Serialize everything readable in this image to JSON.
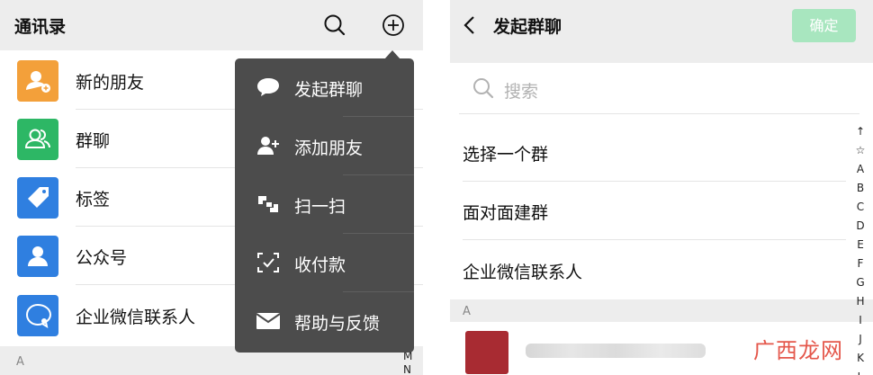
{
  "left": {
    "header": {
      "title": "通讯录"
    },
    "contacts": [
      {
        "label": "新的朋友",
        "color": "#f3a03a",
        "icon": "add-friend-icon"
      },
      {
        "label": "群聊",
        "color": "#2db765",
        "icon": "group-icon"
      },
      {
        "label": "标签",
        "color": "#2f7fe0",
        "icon": "tag-icon"
      },
      {
        "label": "公众号",
        "color": "#2f7fe0",
        "icon": "official-account-icon"
      },
      {
        "label": "企业微信联系人",
        "color": "#2f7fe0",
        "icon": "work-contact-icon"
      }
    ],
    "section": "A",
    "index_letters": [
      "M",
      "N"
    ],
    "popover": [
      {
        "label": "发起群聊",
        "icon": "chat-bubble-icon"
      },
      {
        "label": "添加朋友",
        "icon": "add-friend-icon"
      },
      {
        "label": "扫一扫",
        "icon": "scan-icon"
      },
      {
        "label": "收付款",
        "icon": "payment-icon"
      },
      {
        "label": "帮助与反馈",
        "icon": "mail-icon"
      }
    ]
  },
  "right": {
    "header": {
      "title": "发起群聊",
      "confirm_label": "确定"
    },
    "search": {
      "placeholder": "搜索"
    },
    "options": [
      {
        "label": "选择一个群"
      },
      {
        "label": "面对面建群"
      },
      {
        "label": "企业微信联系人"
      }
    ],
    "section": "A",
    "index_letters": [
      "↑",
      "☆",
      "A",
      "B",
      "C",
      "D",
      "E",
      "F",
      "G",
      "H",
      "I",
      "J",
      "K",
      "L"
    ],
    "watermark": "广西龙网"
  },
  "colors": {
    "header_bg": "#ededed",
    "popover_bg": "#4c4c4c",
    "confirm_disabled": "#a8e6bf"
  }
}
